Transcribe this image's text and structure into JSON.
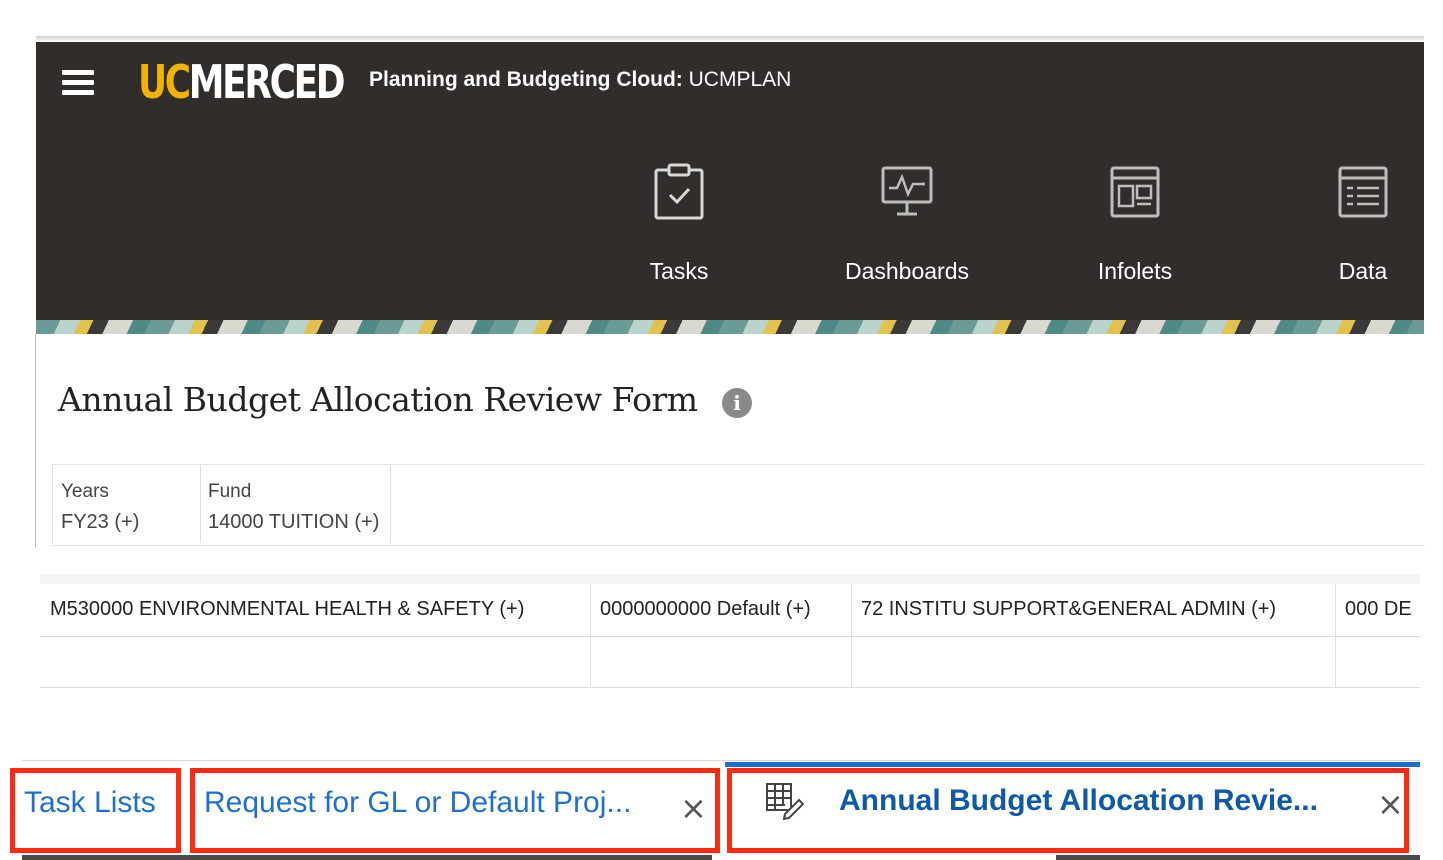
{
  "header": {
    "logo_uc": "UC",
    "logo_merced": "MERCED",
    "app_title_bold": "Planning and Budgeting Cloud:",
    "app_title_rest": " UCMPLAN",
    "bg_color": "#312d2a",
    "nav": [
      {
        "label": "Tasks",
        "icon": "clipboard-check-icon"
      },
      {
        "label": "Dashboards",
        "icon": "monitor-chart-icon"
      },
      {
        "label": "Infolets",
        "icon": "infolets-icon"
      },
      {
        "label": "Data",
        "icon": "data-form-icon"
      }
    ]
  },
  "form": {
    "title": "Annual Budget Allocation Review Form",
    "info_glyph": "i"
  },
  "pov": [
    {
      "label": "Years",
      "value": "FY23 (+)"
    },
    {
      "label": "Fund",
      "value": "14000 TUITION (+)"
    }
  ],
  "grid": {
    "header_cells": [
      "M530000 ENVIRONMENTAL HEALTH & SAFETY (+)",
      "0000000000 Default (+)",
      "72 INSTITU SUPPORT&GENERAL ADMIN (+)",
      "000 DE"
    ],
    "empty_row_cells": [
      "",
      "",
      "",
      ""
    ]
  },
  "tabs": [
    {
      "label": "Task Lists",
      "closable": false,
      "active": false
    },
    {
      "label": "Request for GL or Default Proj...",
      "closable": true,
      "active": false
    },
    {
      "label": "Annual Budget Allocation Revie...",
      "closable": true,
      "active": true,
      "icon": "form-edit-icon"
    }
  ],
  "close_glyph": "×",
  "colors": {
    "accent_gold": "#f0b400",
    "tab_link": "#1f6fcf",
    "active_tab_text": "#0f5aa8",
    "highlight_box": "#ff2a10"
  }
}
